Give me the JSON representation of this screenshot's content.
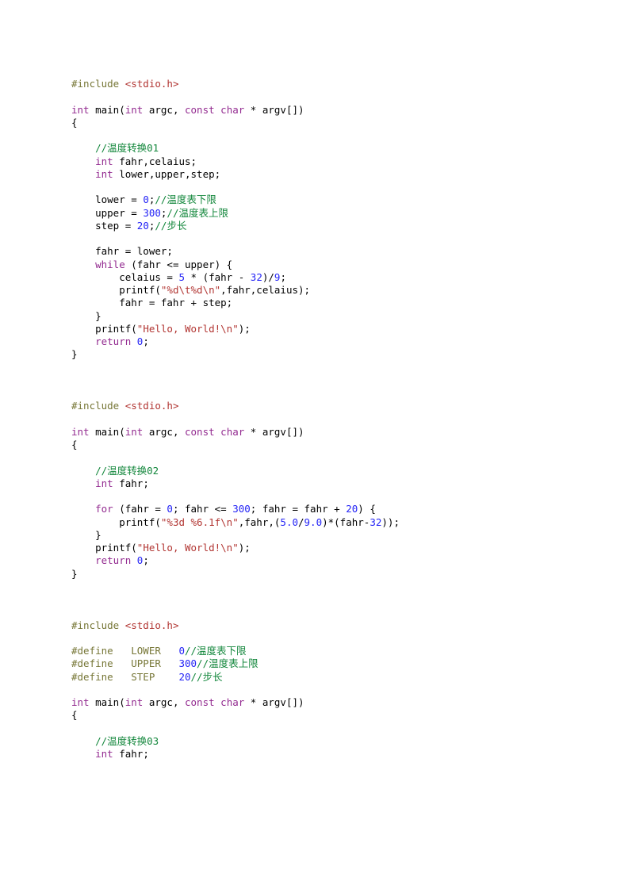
{
  "code_blocks": [
    {
      "lines": [
        [
          {
            "t": "#include ",
            "c": "pp"
          },
          {
            "t": "<stdio.h>",
            "c": "str"
          }
        ],
        [
          {
            "t": "",
            "c": "fn"
          }
        ],
        [
          {
            "t": "int",
            "c": "kw"
          },
          {
            "t": " main(",
            "c": "fn"
          },
          {
            "t": "int",
            "c": "kw"
          },
          {
            "t": " argc, ",
            "c": "fn"
          },
          {
            "t": "const",
            "c": "kw"
          },
          {
            "t": " ",
            "c": "fn"
          },
          {
            "t": "char",
            "c": "kw"
          },
          {
            "t": " * argv[])",
            "c": "fn"
          }
        ],
        [
          {
            "t": "{",
            "c": "fn"
          }
        ],
        [
          {
            "t": "",
            "c": "fn"
          }
        ],
        [
          {
            "t": "    ",
            "c": "fn"
          },
          {
            "t": "//温度转换01",
            "c": "cm"
          }
        ],
        [
          {
            "t": "    ",
            "c": "fn"
          },
          {
            "t": "int",
            "c": "kw"
          },
          {
            "t": " fahr,celaius;",
            "c": "fn"
          }
        ],
        [
          {
            "t": "    ",
            "c": "fn"
          },
          {
            "t": "int",
            "c": "kw"
          },
          {
            "t": " lower,upper,step;",
            "c": "fn"
          }
        ],
        [
          {
            "t": "",
            "c": "fn"
          }
        ],
        [
          {
            "t": "    lower = ",
            "c": "fn"
          },
          {
            "t": "0",
            "c": "num"
          },
          {
            "t": ";",
            "c": "fn"
          },
          {
            "t": "//温度表下限",
            "c": "cm"
          }
        ],
        [
          {
            "t": "    upper = ",
            "c": "fn"
          },
          {
            "t": "300",
            "c": "num"
          },
          {
            "t": ";",
            "c": "fn"
          },
          {
            "t": "//温度表上限",
            "c": "cm"
          }
        ],
        [
          {
            "t": "    step = ",
            "c": "fn"
          },
          {
            "t": "20",
            "c": "num"
          },
          {
            "t": ";",
            "c": "fn"
          },
          {
            "t": "//步长",
            "c": "cm"
          }
        ],
        [
          {
            "t": "",
            "c": "fn"
          }
        ],
        [
          {
            "t": "    fahr = lower;",
            "c": "fn"
          }
        ],
        [
          {
            "t": "    ",
            "c": "fn"
          },
          {
            "t": "while",
            "c": "kw"
          },
          {
            "t": " (fahr <= upper) {",
            "c": "fn"
          }
        ],
        [
          {
            "t": "        celaius = ",
            "c": "fn"
          },
          {
            "t": "5",
            "c": "num"
          },
          {
            "t": " * (fahr - ",
            "c": "fn"
          },
          {
            "t": "32",
            "c": "num"
          },
          {
            "t": ")/",
            "c": "fn"
          },
          {
            "t": "9",
            "c": "num"
          },
          {
            "t": ";",
            "c": "fn"
          }
        ],
        [
          {
            "t": "        printf(",
            "c": "fn"
          },
          {
            "t": "\"%d\\t%d\\n\"",
            "c": "str"
          },
          {
            "t": ",fahr,celaius);",
            "c": "fn"
          }
        ],
        [
          {
            "t": "        fahr = fahr + step;",
            "c": "fn"
          }
        ],
        [
          {
            "t": "    }",
            "c": "fn"
          }
        ],
        [
          {
            "t": "    printf(",
            "c": "fn"
          },
          {
            "t": "\"Hello, World!\\n\"",
            "c": "str"
          },
          {
            "t": ");",
            "c": "fn"
          }
        ],
        [
          {
            "t": "    ",
            "c": "fn"
          },
          {
            "t": "return",
            "c": "kw"
          },
          {
            "t": " ",
            "c": "fn"
          },
          {
            "t": "0",
            "c": "num"
          },
          {
            "t": ";",
            "c": "fn"
          }
        ],
        [
          {
            "t": "}",
            "c": "fn"
          }
        ],
        [
          {
            "t": "",
            "c": "fn"
          }
        ],
        [
          {
            "t": "",
            "c": "fn"
          }
        ],
        [
          {
            "t": "",
            "c": "fn"
          }
        ],
        [
          {
            "t": "#include ",
            "c": "pp"
          },
          {
            "t": "<stdio.h>",
            "c": "str"
          }
        ],
        [
          {
            "t": "",
            "c": "fn"
          }
        ],
        [
          {
            "t": "int",
            "c": "kw"
          },
          {
            "t": " main(",
            "c": "fn"
          },
          {
            "t": "int",
            "c": "kw"
          },
          {
            "t": " argc, ",
            "c": "fn"
          },
          {
            "t": "const",
            "c": "kw"
          },
          {
            "t": " ",
            "c": "fn"
          },
          {
            "t": "char",
            "c": "kw"
          },
          {
            "t": " * argv[])",
            "c": "fn"
          }
        ],
        [
          {
            "t": "{",
            "c": "fn"
          }
        ],
        [
          {
            "t": "",
            "c": "fn"
          }
        ],
        [
          {
            "t": "    ",
            "c": "fn"
          },
          {
            "t": "//温度转换02",
            "c": "cm"
          }
        ],
        [
          {
            "t": "    ",
            "c": "fn"
          },
          {
            "t": "int",
            "c": "kw"
          },
          {
            "t": " fahr;",
            "c": "fn"
          }
        ],
        [
          {
            "t": "",
            "c": "fn"
          }
        ],
        [
          {
            "t": "    ",
            "c": "fn"
          },
          {
            "t": "for",
            "c": "kw"
          },
          {
            "t": " (fahr = ",
            "c": "fn"
          },
          {
            "t": "0",
            "c": "num"
          },
          {
            "t": "; fahr <= ",
            "c": "fn"
          },
          {
            "t": "300",
            "c": "num"
          },
          {
            "t": "; fahr = fahr + ",
            "c": "fn"
          },
          {
            "t": "20",
            "c": "num"
          },
          {
            "t": ") {",
            "c": "fn"
          }
        ],
        [
          {
            "t": "        printf(",
            "c": "fn"
          },
          {
            "t": "\"%3d %6.1f\\n\"",
            "c": "str"
          },
          {
            "t": ",fahr,(",
            "c": "fn"
          },
          {
            "t": "5.0",
            "c": "num"
          },
          {
            "t": "/",
            "c": "fn"
          },
          {
            "t": "9.0",
            "c": "num"
          },
          {
            "t": ")*(fahr-",
            "c": "fn"
          },
          {
            "t": "32",
            "c": "num"
          },
          {
            "t": "));",
            "c": "fn"
          }
        ],
        [
          {
            "t": "    }",
            "c": "fn"
          }
        ],
        [
          {
            "t": "    printf(",
            "c": "fn"
          },
          {
            "t": "\"Hello, World!\\n\"",
            "c": "str"
          },
          {
            "t": ");",
            "c": "fn"
          }
        ],
        [
          {
            "t": "    ",
            "c": "fn"
          },
          {
            "t": "return",
            "c": "kw"
          },
          {
            "t": " ",
            "c": "fn"
          },
          {
            "t": "0",
            "c": "num"
          },
          {
            "t": ";",
            "c": "fn"
          }
        ],
        [
          {
            "t": "}",
            "c": "fn"
          }
        ],
        [
          {
            "t": "",
            "c": "fn"
          }
        ],
        [
          {
            "t": "",
            "c": "fn"
          }
        ],
        [
          {
            "t": "",
            "c": "fn"
          }
        ],
        [
          {
            "t": "#include ",
            "c": "pp"
          },
          {
            "t": "<stdio.h>",
            "c": "str"
          }
        ],
        [
          {
            "t": "",
            "c": "fn"
          }
        ],
        [
          {
            "t": "#define   LOWER   ",
            "c": "pp"
          },
          {
            "t": "0",
            "c": "num"
          },
          {
            "t": "//温度表下限",
            "c": "cm"
          }
        ],
        [
          {
            "t": "#define   UPPER   ",
            "c": "pp"
          },
          {
            "t": "300",
            "c": "num"
          },
          {
            "t": "//温度表上限",
            "c": "cm"
          }
        ],
        [
          {
            "t": "#define   STEP    ",
            "c": "pp"
          },
          {
            "t": "20",
            "c": "num"
          },
          {
            "t": "//步长",
            "c": "cm"
          }
        ],
        [
          {
            "t": "",
            "c": "fn"
          }
        ],
        [
          {
            "t": "int",
            "c": "kw"
          },
          {
            "t": " main(",
            "c": "fn"
          },
          {
            "t": "int",
            "c": "kw"
          },
          {
            "t": " argc, ",
            "c": "fn"
          },
          {
            "t": "const",
            "c": "kw"
          },
          {
            "t": " ",
            "c": "fn"
          },
          {
            "t": "char",
            "c": "kw"
          },
          {
            "t": " * argv[])",
            "c": "fn"
          }
        ],
        [
          {
            "t": "{",
            "c": "fn"
          }
        ],
        [
          {
            "t": "",
            "c": "fn"
          }
        ],
        [
          {
            "t": "    ",
            "c": "fn"
          },
          {
            "t": "//温度转换03",
            "c": "cm"
          }
        ],
        [
          {
            "t": "    ",
            "c": "fn"
          },
          {
            "t": "int",
            "c": "kw"
          },
          {
            "t": " fahr;",
            "c": "fn"
          }
        ]
      ]
    }
  ]
}
